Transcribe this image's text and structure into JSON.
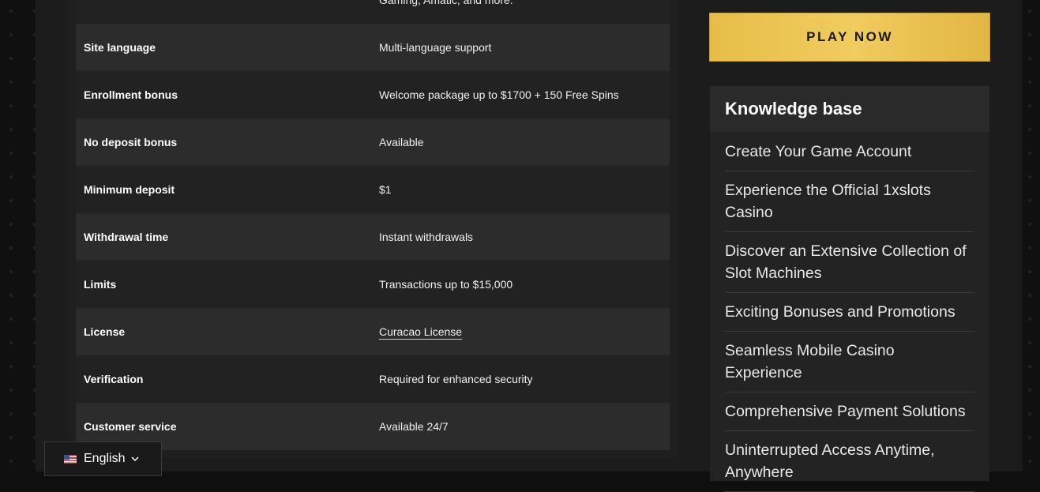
{
  "table": {
    "partial_top_value": "Gaming, Amatic, and more.",
    "rows": [
      {
        "label": "Site language",
        "value": "Multi-language support"
      },
      {
        "label": "Enrollment bonus",
        "value": "Welcome package up to $1700 + 150 Free Spins"
      },
      {
        "label": "No deposit bonus",
        "value": "Available"
      },
      {
        "label": "Minimum deposit",
        "value": "$1"
      },
      {
        "label": "Withdrawal time",
        "value": "Instant withdrawals"
      },
      {
        "label": "Limits",
        "value": "Transactions up to $15,000"
      },
      {
        "label": "License",
        "value": "Curacao License"
      },
      {
        "label": "Verification",
        "value": "Required for enhanced security"
      },
      {
        "label": "Customer service",
        "value": "Available 24/7"
      }
    ]
  },
  "sidebar": {
    "play_button": "PLAY NOW",
    "knowledge_base": {
      "title": "Knowledge base",
      "items": [
        "Create Your Game Account",
        "Experience the Official 1xslots Casino",
        "Discover an Extensive Collection of Slot Machines",
        "Exciting Bonuses and Promotions",
        "Seamless Mobile Casino Experience",
        "Comprehensive Payment Solutions",
        "Uninterrupted Access Anytime, Anywhere"
      ]
    }
  },
  "language_switcher": {
    "label": "English",
    "flag_icon": "us-flag-icon",
    "chevron_icon": "chevron-down-icon"
  },
  "colors": {
    "accent_gold": "#efc95a",
    "panel_dark": "#1c1c1c",
    "row_alt": "#2c2c2c"
  }
}
